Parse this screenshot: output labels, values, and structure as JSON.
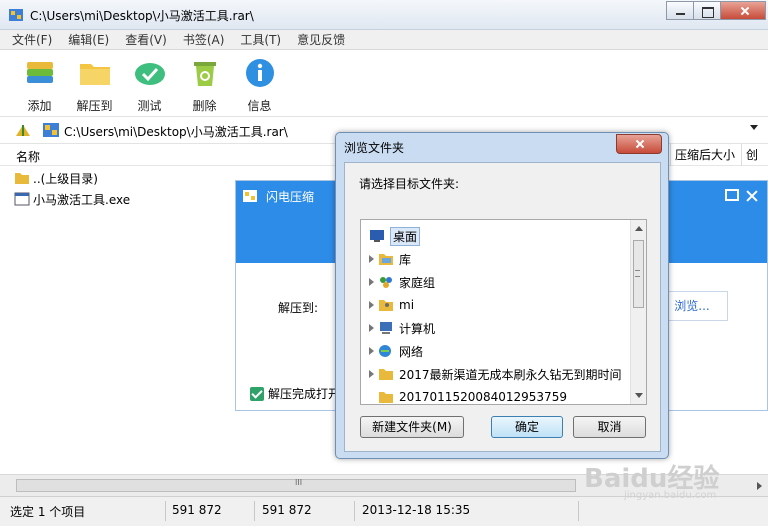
{
  "window": {
    "title": "C:\\Users\\mi\\Desktop\\小马激活工具.rar\\"
  },
  "menu": [
    "文件(F)",
    "编辑(E)",
    "查看(V)",
    "书签(A)",
    "工具(T)",
    "意见反馈"
  ],
  "toolbar": [
    {
      "label": "添加",
      "icon": "add-archive-icon"
    },
    {
      "label": "解压到",
      "icon": "folder-icon"
    },
    {
      "label": "测试",
      "icon": "test-check-icon"
    },
    {
      "label": "删除",
      "icon": "recycle-bin-icon"
    },
    {
      "label": "信息",
      "icon": "info-icon"
    }
  ],
  "address": {
    "path": "C:\\Users\\mi\\Desktop\\小马激活工具.rar\\"
  },
  "columns": {
    "name": "名称",
    "compressed": "压缩后大小",
    "created": "创"
  },
  "files": [
    {
      "name": "..(上级目录)",
      "icon": "folder-up-icon"
    },
    {
      "name": "小马激活工具.exe",
      "icon": "exe-icon"
    }
  ],
  "hscroll": {
    "grip": "III"
  },
  "status": {
    "selection": "选定 1 个项目",
    "size": "591 872",
    "packed": "591 872",
    "date": "2013-12-18 15:35"
  },
  "flash_dialog": {
    "title": "闪电压缩",
    "extract_label": "解压到:",
    "browse_label": "浏览...",
    "checkbox_label": "解压完成打开"
  },
  "browse_dialog": {
    "title": "浏览文件夹",
    "prompt": "请选择目标文件夹:",
    "tree": [
      {
        "label": "桌面",
        "icon": "desktop-icon",
        "expand": false,
        "selected": true
      },
      {
        "label": "库",
        "icon": "library-icon",
        "expand": true
      },
      {
        "label": "家庭组",
        "icon": "homegroup-icon",
        "expand": true
      },
      {
        "label": "mi",
        "icon": "user-folder-icon",
        "expand": true
      },
      {
        "label": "计算机",
        "icon": "computer-icon",
        "expand": true
      },
      {
        "label": "网络",
        "icon": "network-icon",
        "expand": true
      },
      {
        "label": "2017最新渠道无成本刷永久钻无到期时间",
        "icon": "folder-icon",
        "expand": true
      },
      {
        "label": "20170115200840129537​59",
        "icon": "folder-icon",
        "expand": false
      }
    ],
    "new_folder": "新建文件夹(M)",
    "ok": "确定",
    "cancel": "取消"
  },
  "watermark": {
    "main": "Baidu经验",
    "sub": "jingyan.baidu.com"
  },
  "colors": {
    "accent_blue": "#2d8ce8",
    "close_red": "#c74b3a"
  }
}
